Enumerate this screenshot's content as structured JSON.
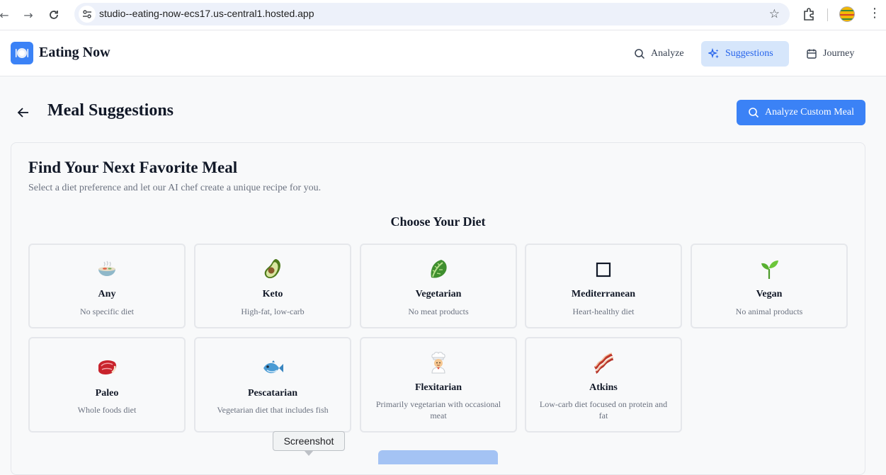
{
  "browser": {
    "url": "studio--eating-now-ecs17.us-central1.hosted.app",
    "tooltip": "Screenshot"
  },
  "app": {
    "name": "Eating Now",
    "nav": [
      {
        "label": "Analyze",
        "icon": "search-icon",
        "active": false
      },
      {
        "label": "Suggestions",
        "icon": "sparkles-icon",
        "active": true
      },
      {
        "label": "Journey",
        "icon": "calendar-icon",
        "active": false
      }
    ]
  },
  "page": {
    "title": "Meal Suggestions",
    "primary_button": "Analyze Custom Meal"
  },
  "card": {
    "title": "Find Your Next Favorite Meal",
    "subtitle": "Select a diet preference and let our AI chef create a unique recipe for you.",
    "section_title": "Choose Your Diet",
    "diets": [
      {
        "name": "Any",
        "desc": "No specific diet",
        "icon": "bowl-emoji"
      },
      {
        "name": "Keto",
        "desc": "High-fat, low-carb",
        "icon": "avocado-emoji"
      },
      {
        "name": "Vegetarian",
        "desc": "No meat products",
        "icon": "leafy-green-emoji"
      },
      {
        "name": "Mediterranean",
        "desc": "Heart-healthy diet",
        "icon": "empty-square-emoji"
      },
      {
        "name": "Vegan",
        "desc": "No animal products",
        "icon": "seedling-emoji"
      },
      {
        "name": "Paleo",
        "desc": "Whole foods diet",
        "icon": "meat-emoji"
      },
      {
        "name": "Pescatarian",
        "desc": "Vegetarian diet that includes fish",
        "icon": "fish-emoji"
      },
      {
        "name": "Flexitarian",
        "desc": "Primarily vegetarian with occasional meat",
        "icon": "cook-emoji"
      },
      {
        "name": "Atkins",
        "desc": "Low-carb diet focused on protein and fat",
        "icon": "bacon-emoji"
      }
    ]
  },
  "colors": {
    "accent": "#3b82f6",
    "active_nav_bg": "#d6e6fb",
    "page_bg": "#f8f9fa"
  }
}
